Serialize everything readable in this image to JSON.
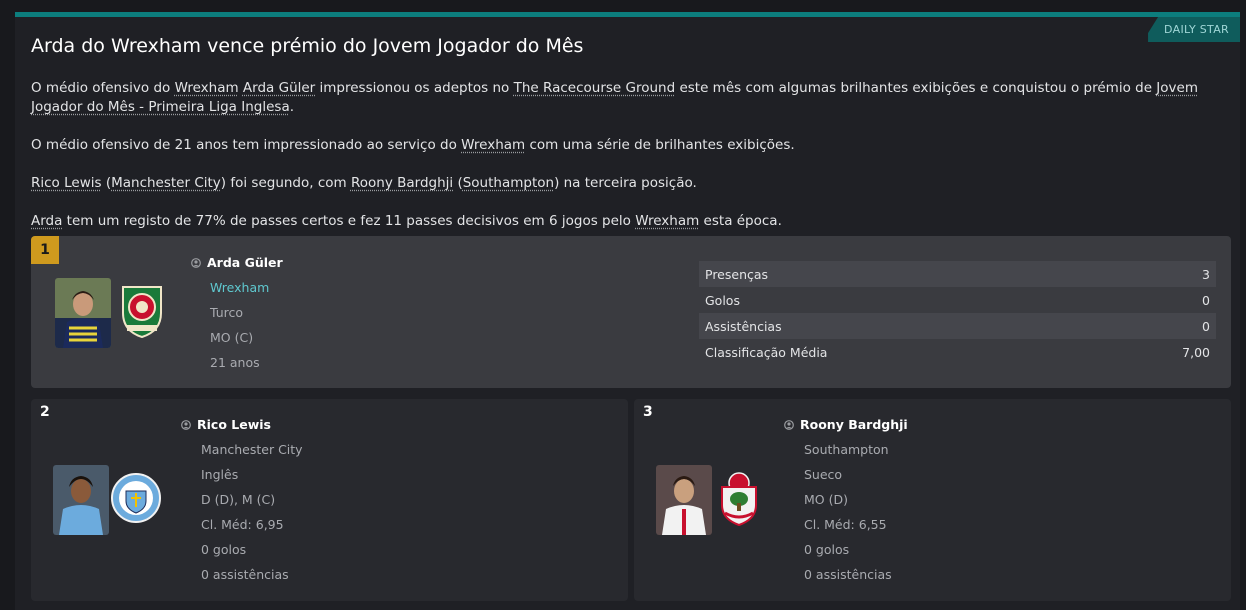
{
  "source_badge": "DAILY STAR",
  "headline": "Arda do Wrexham vence prémio do Jovem Jogador do Mês",
  "paragraph1": {
    "t1": "O médio ofensivo do ",
    "club": "Wrexham",
    "t2": " ",
    "player": "Arda Güler",
    "t3": " impressionou os adeptos no ",
    "stadium": "The Racecourse Ground",
    "t4": " este mês com algumas brilhantes exibições e conquistou o prémio de ",
    "award": "Jovem Jogador do Mês - Primeira Liga Inglesa",
    "t5": "."
  },
  "paragraph2": {
    "t1": "O médio ofensivo de 21 anos tem impressionado ao serviço do ",
    "club": "Wrexham",
    "t2": " com uma série de brilhantes exibições."
  },
  "paragraph3": {
    "p2": "Rico Lewis",
    "t1": " (",
    "c2": "Manchester City",
    "t2": ") foi segundo, com ",
    "p3": "Roony Bardghji",
    "t3": " (",
    "c3": "Southampton",
    "t4": ") na terceira posição."
  },
  "paragraph4": {
    "player": "Arda",
    "t1": " tem um registo de 77% de passes certos e fez 11 passes decisivos em 6 jogos pelo ",
    "club": "Wrexham",
    "t2": " esta época."
  },
  "winner": {
    "rank": "1",
    "name": "Arda Güler",
    "club": "Wrexham",
    "nationality": "Turco",
    "position": "MO (C)",
    "age": "21 anos",
    "stats": [
      {
        "label": "Presenças",
        "value": "3"
      },
      {
        "label": "Golos",
        "value": "0"
      },
      {
        "label": "Assistências",
        "value": "0"
      },
      {
        "label": "Classificação Média",
        "value": "7,00"
      }
    ]
  },
  "runners": [
    {
      "rank": "2",
      "name": "Rico Lewis",
      "club": "Manchester City",
      "nationality": "Inglês",
      "position": "D (D), M (C)",
      "rating": "Cl. Méd: 6,95",
      "goals": "0 golos",
      "assists": "0 assistências"
    },
    {
      "rank": "3",
      "name": "Roony Bardghji",
      "club": "Southampton",
      "nationality": "Sueco",
      "position": "MO (D)",
      "rating": "Cl. Méd: 6,55",
      "goals": "0 golos",
      "assists": "0 assistências"
    }
  ],
  "colors": {
    "accent": "#0c7d7d",
    "gold": "#cf9a1e",
    "link": "#5fc8cf"
  }
}
